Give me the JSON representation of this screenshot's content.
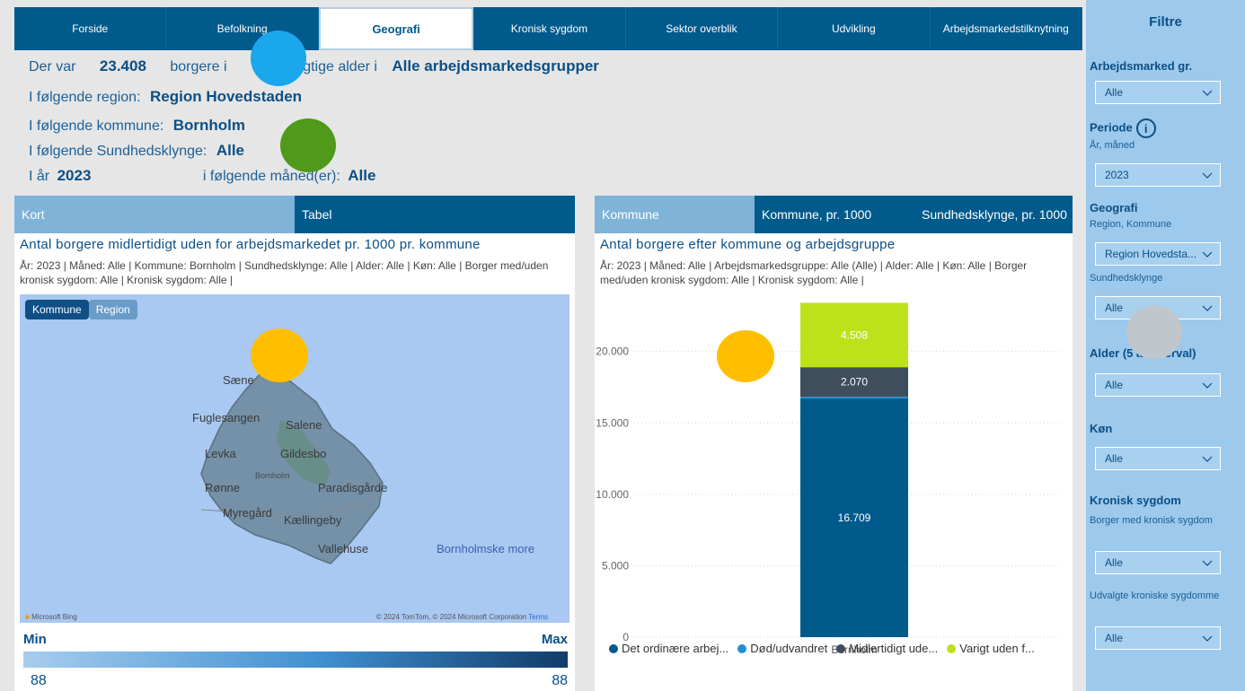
{
  "nav": {
    "tabs": [
      "Forside",
      "Befolkning",
      "Geografi",
      "Kronisk sygdom",
      "Sektor overblik",
      "Udvikling",
      "Arbejdsmarkedstilknytning"
    ],
    "active_index": 2
  },
  "summary": {
    "line1_prefix": "Der var",
    "total": "23.408",
    "line1_mid": "borgere i ",
    "line1_mid2": "ejdsdygtige alder i",
    "group": "Alle arbejdsmarkedsgrupper",
    "region_label": "I følgende region:",
    "region": "Region Hovedstaden",
    "kommune_label": "I følgende kommune:",
    "kommune": "Bornholm",
    "klynge_label": "I følgende Sundhedsklynge:",
    "klynge": "Alle",
    "year_label": "I år",
    "year": "2023",
    "month_label": "i følgende måned(er):",
    "month": "Alle"
  },
  "map_panel": {
    "tabs": [
      "Kort",
      "Tabel"
    ],
    "title": "Antal borgere midlertidigt uden for arbejdsmarkedet pr. 1000 pr. kommune",
    "desc": "År: 2023 | Måned: Alle | Kommune: Bornholm | Sundhedsklynge: Alle | Alder: Alle | Køn: Alle | Borger med/uden kronisk sygdom: Alle | Kronisk sygdom: Alle |",
    "toggle": [
      "Kommune",
      "Region"
    ],
    "places": [
      "Sæne",
      "Fuglesangen",
      "Salene",
      "Levka",
      "Gildesbo",
      "Bornholm",
      "Rønne",
      "Paradisgårde",
      "Myregård",
      "Kællingeby",
      "Vallehuse",
      "Bornholmske more"
    ],
    "credit_left": "Microsoft Bing",
    "credit_right": "© 2024 TomTom, © 2024 Microsoft Corporation",
    "credit_terms": "Terms",
    "legend_min": "Min",
    "legend_max": "Max",
    "legend_min_value": "88",
    "legend_max_value": "88"
  },
  "chart_panel": {
    "tabs": [
      "Kommune",
      "Kommune, pr. 1000",
      "Sundhedsklynge, pr. 1000"
    ],
    "title": "Antal borgere efter kommune og arbejdsgruppe",
    "desc": "År: 2023 | Måned: Alle | Arbejdsmarkedsgruppe: Alle (Alle) | Alder: Alle | Køn: Alle | Borger med/uden kronisk sygdom: Alle | Kronisk sygdom: Alle |"
  },
  "chart_data": {
    "type": "bar",
    "stacked": true,
    "categories": [
      "Bornholm"
    ],
    "series": [
      {
        "name": "Det ordinære arbej...",
        "values": [
          16709
        ],
        "label": "16.709",
        "color": "#005a8c"
      },
      {
        "name": "Død/udvandret",
        "values": [
          121
        ],
        "label": "",
        "color": "#1f8fd6"
      },
      {
        "name": "Midlertidigt ude...",
        "values": [
          2070
        ],
        "label": "2.070",
        "color": "#3f4e5c"
      },
      {
        "name": "Varigt uden f...",
        "values": [
          4508
        ],
        "label": "4.508",
        "color": "#bde21a"
      }
    ],
    "ylim": [
      0,
      24000
    ],
    "yticks": [
      0,
      5000,
      10000,
      15000,
      20000
    ],
    "ytick_labels": [
      "0",
      "5.000",
      "10.000",
      "15.000",
      "20.000"
    ],
    "grid": true,
    "legend": "bottom"
  },
  "filters": {
    "title": "Filtre",
    "arbejdsmarked_label": "Arbejdsmarked gr.",
    "arbejdsmarked_value": "Alle",
    "periode_label": "Periode",
    "periode_sub": "År, måned",
    "periode_value": "2023",
    "geografi_label": "Geografi",
    "geografi_sub": "Region, Kommune",
    "geografi_value": "Region Hovedsta...",
    "klynge_sub": "Sundhedsklynge",
    "klynge_value": "Alle",
    "alder_label": "Alder (5 år interval)",
    "alder_value": "Alle",
    "kon_label": "Køn",
    "kon_value": "Alle",
    "kronisk_label": "Kronisk sygdom",
    "kronisk_sub": "Borger med kronisk sygdom",
    "kronisk_value": "Alle",
    "udvalgte_sub": "Udvalgte kroniske sygdomme",
    "udvalgte_value": "Alle"
  },
  "colors": {
    "brand": "#005a8c",
    "accent_light": "#7fb3d8",
    "filter_bg": "#9cc9ec",
    "marker_blue": "#1aa7ec",
    "marker_green": "#4f9a1a",
    "marker_orange": "#ffbf00",
    "marker_gray": "#bfc6cc"
  }
}
